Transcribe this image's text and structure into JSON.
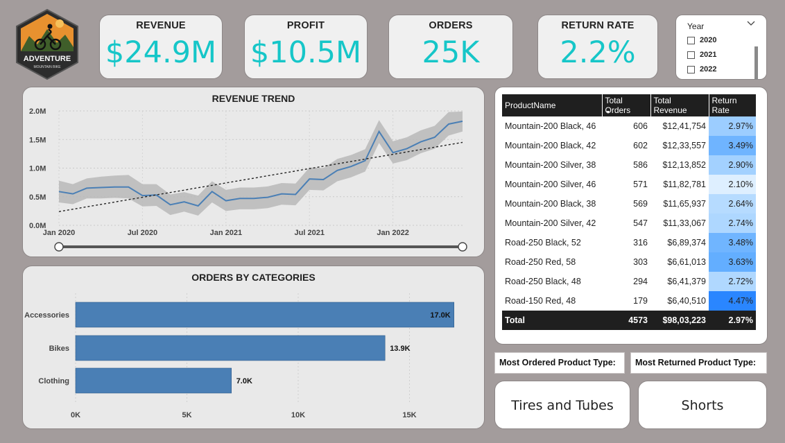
{
  "logo": {
    "text_top": "ADVENTURE",
    "text_bottom": "MOUNTAIN BIKE"
  },
  "kpis": [
    {
      "label": "REVENUE",
      "value": "$24.9M"
    },
    {
      "label": "PROFIT",
      "value": "$10.5M"
    },
    {
      "label": "ORDERS",
      "value": "25K"
    },
    {
      "label": "RETURN RATE",
      "value": "2.2%"
    }
  ],
  "year_slicer": {
    "title": "Year",
    "options": [
      "2020",
      "2021",
      "2022"
    ],
    "icon": "chevron-down-icon"
  },
  "revenue_trend": {
    "title": "REVENUE TREND",
    "y_ticks": [
      "2.0M",
      "1.5M",
      "1.0M",
      "0.5M",
      "0.0M"
    ],
    "x_ticks": [
      "Jan 2020",
      "Jul 2020",
      "Jan 2021",
      "Jul 2021",
      "Jan 2022"
    ]
  },
  "orders_by_categories": {
    "title": "ORDERS BY CATEGORIES",
    "x_ticks": [
      "0K",
      "5K",
      "10K",
      "15K"
    ]
  },
  "table": {
    "headers": [
      "ProductName",
      "Total Orders",
      "Total Revenue",
      "Return Rate"
    ],
    "rows": [
      {
        "name": "Mountain-200 Black, 46",
        "orders": "606",
        "revenue": "$12,41,754",
        "rate": "2.97%",
        "rate_color": "#9ccdff"
      },
      {
        "name": "Mountain-200 Black, 42",
        "orders": "602",
        "revenue": "$12,33,557",
        "rate": "3.49%",
        "rate_color": "#6fb4ff"
      },
      {
        "name": "Mountain-200 Silver, 38",
        "orders": "586",
        "revenue": "$12,13,852",
        "rate": "2.90%",
        "rate_color": "#a3d1ff"
      },
      {
        "name": "Mountain-200 Silver, 46",
        "orders": "571",
        "revenue": "$11,82,781",
        "rate": "2.10%",
        "rate_color": "#deefff"
      },
      {
        "name": "Mountain-200 Black, 38",
        "orders": "569",
        "revenue": "$11,65,937",
        "rate": "2.64%",
        "rate_color": "#b6dbff"
      },
      {
        "name": "Mountain-200 Silver, 42",
        "orders": "547",
        "revenue": "$11,33,067",
        "rate": "2.74%",
        "rate_color": "#aed7ff"
      },
      {
        "name": "Road-250 Black, 52",
        "orders": "316",
        "revenue": "$6,89,374",
        "rate": "3.48%",
        "rate_color": "#70b5ff"
      },
      {
        "name": "Road-250 Red, 58",
        "orders": "303",
        "revenue": "$6,61,013",
        "rate": "3.63%",
        "rate_color": "#63aeff"
      },
      {
        "name": "Road-250 Black, 48",
        "orders": "294",
        "revenue": "$6,41,379",
        "rate": "2.72%",
        "rate_color": "#b0d8ff"
      },
      {
        "name": "Road-150 Red, 48",
        "orders": "179",
        "revenue": "$6,40,510",
        "rate": "4.47%",
        "rate_color": "#2a86ff"
      }
    ],
    "total": {
      "label": "Total",
      "orders": "4573",
      "revenue": "$98,03,223",
      "rate": "2.97%"
    }
  },
  "most_ordered": {
    "label": "Most Ordered Product Type:",
    "value": "Tires and Tubes"
  },
  "most_returned": {
    "label": "Most Returned Product Type:",
    "value": "Shorts"
  },
  "colors": {
    "kpi_value": "#16c6c8",
    "bar": "#4a7fb5",
    "line": "#4a7fb5",
    "band": "#b9b9b9",
    "background": "#a39c9c"
  },
  "chart_data": [
    {
      "type": "line",
      "title": "REVENUE TREND",
      "x": [
        "2020-01",
        "2020-02",
        "2020-03",
        "2020-04",
        "2020-05",
        "2020-06",
        "2020-07",
        "2020-08",
        "2020-09",
        "2020-10",
        "2020-11",
        "2020-12",
        "2021-01",
        "2021-02",
        "2021-03",
        "2021-04",
        "2021-05",
        "2021-06",
        "2021-07",
        "2021-08",
        "2021-09",
        "2021-10",
        "2021-11",
        "2021-12",
        "2022-01",
        "2022-02",
        "2022-03",
        "2022-04",
        "2022-05",
        "2022-06"
      ],
      "series": [
        {
          "values": [
            0.59,
            0.55,
            0.65,
            0.66,
            0.67,
            0.67,
            0.52,
            0.53,
            0.36,
            0.41,
            0.34,
            0.59,
            0.43,
            0.47,
            0.47,
            0.49,
            0.55,
            0.54,
            0.81,
            0.8,
            0.96,
            1.03,
            1.13,
            1.64,
            1.27,
            1.34,
            1.46,
            1.54,
            1.77,
            1.82
          ]
        }
      ],
      "band_upper": [
        0.78,
        0.72,
        0.82,
        0.85,
        0.87,
        0.88,
        0.72,
        0.72,
        0.54,
        0.58,
        0.52,
        0.77,
        0.62,
        0.66,
        0.66,
        0.68,
        0.74,
        0.73,
        1.01,
        1.0,
        1.16,
        1.23,
        1.33,
        1.84,
        1.47,
        1.54,
        1.66,
        1.74,
        1.98,
        1.99
      ],
      "band_lower": [
        0.4,
        0.37,
        0.47,
        0.47,
        0.48,
        0.47,
        0.33,
        0.34,
        0.18,
        0.24,
        0.17,
        0.4,
        0.25,
        0.28,
        0.28,
        0.3,
        0.36,
        0.35,
        0.62,
        0.61,
        0.77,
        0.84,
        0.94,
        1.44,
        1.08,
        1.14,
        1.26,
        1.34,
        1.57,
        1.64
      ],
      "trendline": [
        0.24,
        1.45
      ],
      "ylim": [
        0,
        2.0
      ],
      "y_unit": "M"
    },
    {
      "type": "bar",
      "orientation": "horizontal",
      "title": "ORDERS BY CATEGORIES",
      "categories": [
        "Accessories",
        "Bikes",
        "Clothing"
      ],
      "values": [
        17.0,
        13.9,
        7.0
      ],
      "value_labels": [
        "17.0K",
        "13.9K",
        "7.0K"
      ],
      "xlim": [
        0,
        18.5
      ]
    }
  ]
}
